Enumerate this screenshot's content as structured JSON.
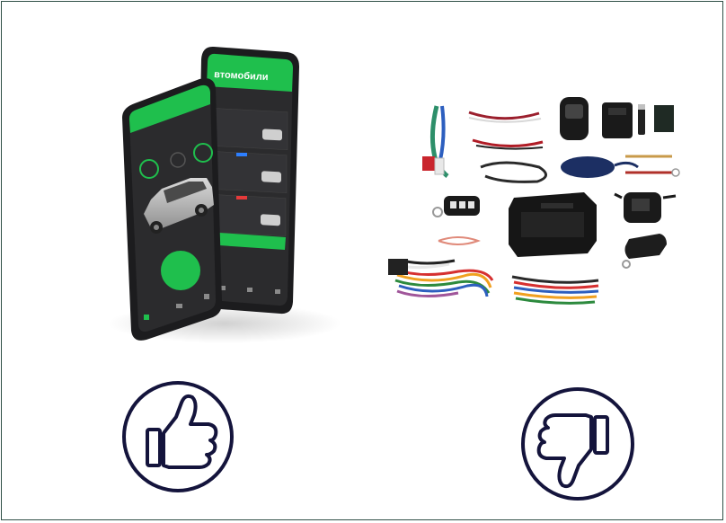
{
  "colors": {
    "frame": "#2f4f46",
    "phone_body": "#1c1c1e",
    "app_bg": "#2b2b2d",
    "app_green": "#1fbf4d",
    "icon_navy": "#14143c",
    "kit_black": "#1a1a1a"
  },
  "icons": {
    "like": "thumbs-up-icon",
    "dislike": "thumbs-down-icon"
  },
  "phone_back": {
    "header_title": "втомобили"
  }
}
